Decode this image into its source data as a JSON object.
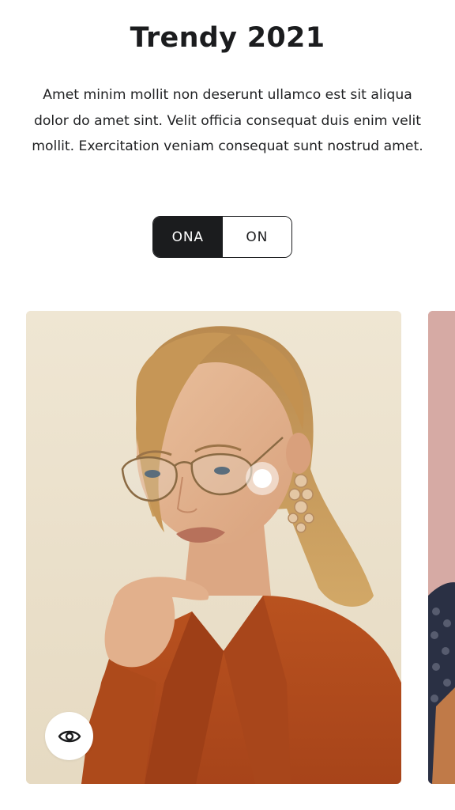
{
  "header": {
    "title": "Trendy 2021",
    "description": "Amet minim mollit non deserunt ullamco est sit aliqua dolor do amet sint. Velit officia consequat duis enim velit mollit. Exercitation veniam consequat sunt nostrud amet."
  },
  "toggle": {
    "options": [
      "ONA",
      "ON"
    ],
    "selected": "ONA"
  },
  "carousel": {
    "cards": [
      {
        "image": "woman-with-glasses-photo",
        "hotspot_icon": "dot-icon",
        "action_icon": "eye-icon"
      },
      {
        "image": "partial-next-card-photo"
      }
    ]
  },
  "colors": {
    "dark": "#1b1c1e",
    "card_background": "#ede3cf",
    "jacket": "#b34c1d",
    "next_card_background": "#d6aaa4"
  }
}
